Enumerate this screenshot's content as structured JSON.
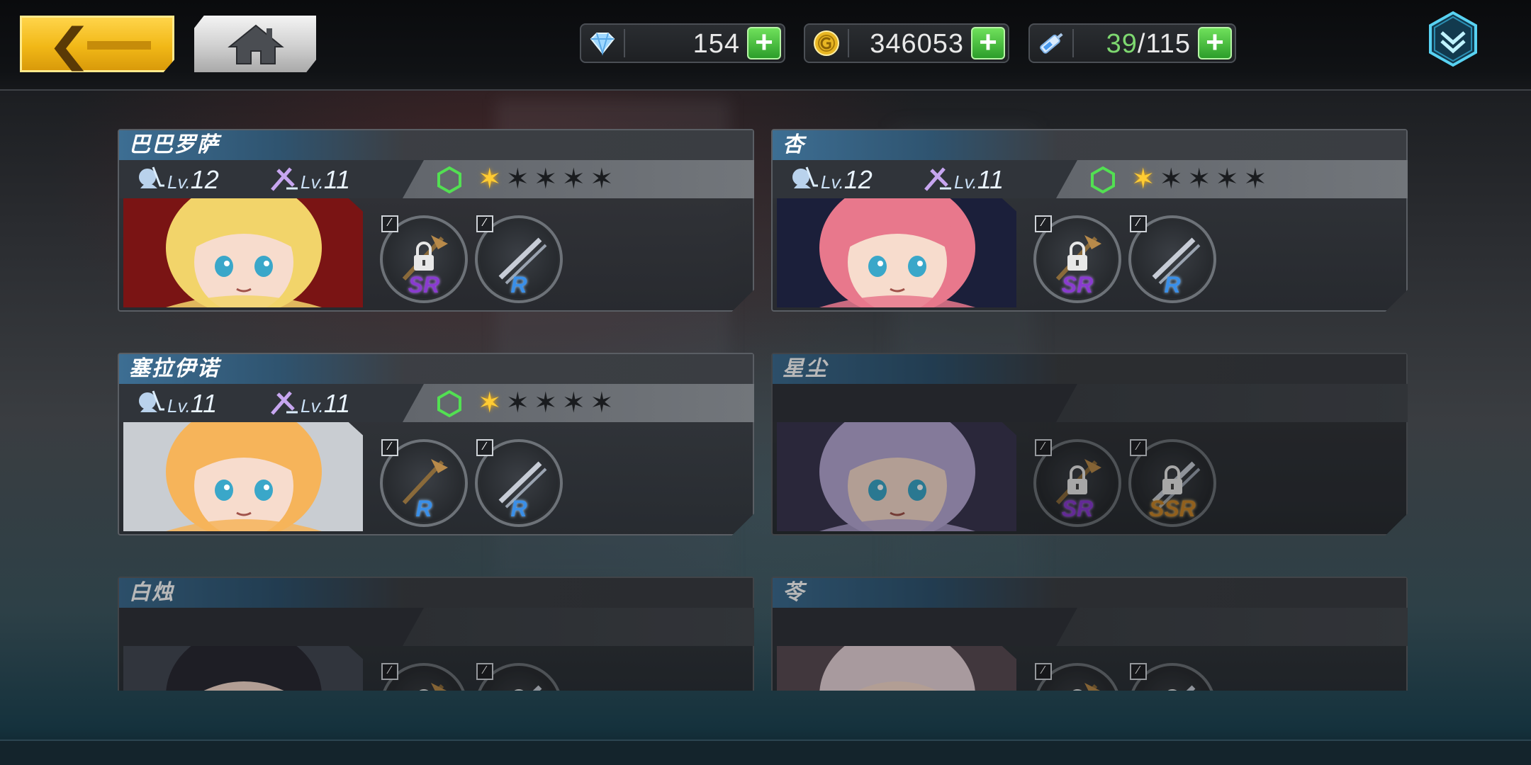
{
  "header": {
    "back_icon": "back-chevron-icon",
    "home_icon": "home-icon",
    "menu_icon": "chevron-down-hex-icon"
  },
  "resources": {
    "diamonds": {
      "icon": "diamond-icon",
      "value": "154"
    },
    "gold": {
      "icon": "gold-coin-icon",
      "value": "346053"
    },
    "stamina": {
      "icon": "syringe-icon",
      "current": "39",
      "separator": "/",
      "max": "115"
    }
  },
  "characters": [
    {
      "name": "巴巴罗萨",
      "level_prefix": "Lv.",
      "char_level": "12",
      "weapon_level": "11",
      "stars": 1,
      "max_stars": 5,
      "unlocked": true,
      "weapons": [
        {
          "rarity": "SR",
          "locked": true
        },
        {
          "rarity": "R",
          "locked": false
        }
      ],
      "colors": {
        "hair": "#f2d46a",
        "bg": "#7a1414"
      }
    },
    {
      "name": "杏",
      "level_prefix": "Lv.",
      "char_level": "12",
      "weapon_level": "11",
      "stars": 1,
      "max_stars": 5,
      "unlocked": true,
      "weapons": [
        {
          "rarity": "SR",
          "locked": true
        },
        {
          "rarity": "R",
          "locked": false
        }
      ],
      "colors": {
        "hair": "#e8788c",
        "bg": "#1b1f3a"
      }
    },
    {
      "name": "塞拉伊诺",
      "level_prefix": "Lv.",
      "char_level": "11",
      "weapon_level": "11",
      "stars": 1,
      "max_stars": 5,
      "unlocked": true,
      "weapons": [
        {
          "rarity": "R",
          "locked": false
        },
        {
          "rarity": "R",
          "locked": false
        }
      ],
      "colors": {
        "hair": "#f6b45a",
        "bg": "#c9cdd2"
      }
    },
    {
      "name": "星尘",
      "unlocked": false,
      "weapons": [
        {
          "rarity": "SR",
          "locked": true
        },
        {
          "rarity": "SSR",
          "locked": true
        }
      ],
      "colors": {
        "hair": "#b7a9d6",
        "bg": "#3a3650"
      }
    },
    {
      "name": "白烛",
      "unlocked": false,
      "weapons": [
        {
          "rarity": "",
          "locked": true
        },
        {
          "rarity": "",
          "locked": true
        }
      ],
      "colors": {
        "hair": "#2a2a34",
        "bg": "#444a55"
      }
    },
    {
      "name": "苓",
      "unlocked": false,
      "weapons": [
        {
          "rarity": "",
          "locked": true
        },
        {
          "rarity": "",
          "locked": true
        }
      ],
      "colors": {
        "hair": "#e9d6dc",
        "bg": "#5a4c55"
      }
    }
  ]
}
